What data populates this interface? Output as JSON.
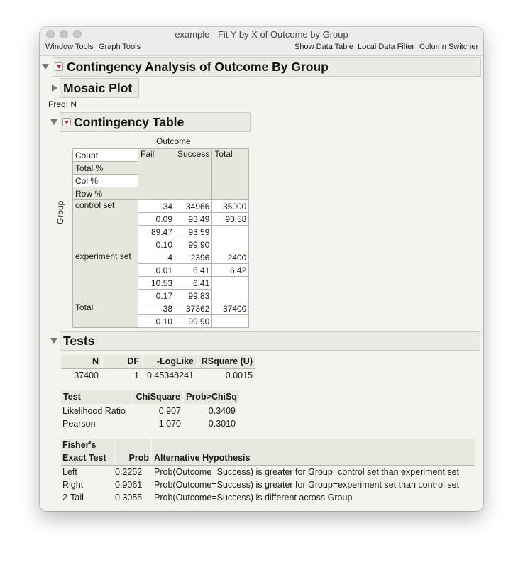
{
  "window": {
    "title": "example - Fit Y by X of Outcome by Group",
    "toolbar": [
      "Window Tools",
      "Graph Tools",
      "Show Data Table",
      "Local Data Filter",
      "Column Switcher"
    ]
  },
  "report": {
    "title": "Contingency Analysis of Outcome By Group",
    "mosaic_title": "Mosaic Plot",
    "freq_label": "Freq: N",
    "ct_title": "Contingency Table",
    "ct_col_var": "Outcome",
    "ct_row_var": "Group",
    "ct_headers": [
      "Fail",
      "Success",
      "Total"
    ],
    "ct_stat_labels": [
      "Count",
      "Total %",
      "Col %",
      "Row %"
    ],
    "ct_rows": [
      {
        "label": "control set",
        "cells": [
          [
            "34",
            "34966",
            "35000"
          ],
          [
            "0.09",
            "93.49",
            "93.58"
          ],
          [
            "89.47",
            "93.59",
            ""
          ],
          [
            "0.10",
            "99.90",
            ""
          ]
        ]
      },
      {
        "label": "experiment set",
        "cells": [
          [
            "4",
            "2396",
            "2400"
          ],
          [
            "0.01",
            "6.41",
            "6.42"
          ],
          [
            "10.53",
            "6.41",
            ""
          ],
          [
            "0.17",
            "99.83",
            ""
          ]
        ]
      },
      {
        "label": "Total",
        "cells": [
          [
            "38",
            "37362",
            "37400"
          ],
          [
            "0.10",
            "99.90",
            ""
          ]
        ]
      }
    ],
    "tests_title": "Tests",
    "summary": {
      "headers": [
        "N",
        "DF",
        "-LogLike",
        "RSquare (U)"
      ],
      "values": [
        "37400",
        "1",
        "0.45348241",
        "0.0015"
      ]
    },
    "chisq": {
      "headers": [
        "Test",
        "ChiSquare",
        "Prob>ChiSq"
      ],
      "rows": [
        [
          "Likelihood Ratio",
          "0.907",
          "0.3409"
        ],
        [
          "Pearson",
          "1.070",
          "0.3010"
        ]
      ]
    },
    "fisher": {
      "headers": [
        "Fisher's",
        "Exact Test",
        "Prob",
        "Alternative Hypothesis"
      ],
      "rows": [
        [
          "Left",
          "0.2252",
          "Prob(Outcome=Success) is greater for Group=control set than experiment set"
        ],
        [
          "Right",
          "0.9061",
          "Prob(Outcome=Success) is greater for Group=experiment set than control set"
        ],
        [
          "2-Tail",
          "0.3055",
          "Prob(Outcome=Success) is different across Group"
        ]
      ]
    }
  }
}
